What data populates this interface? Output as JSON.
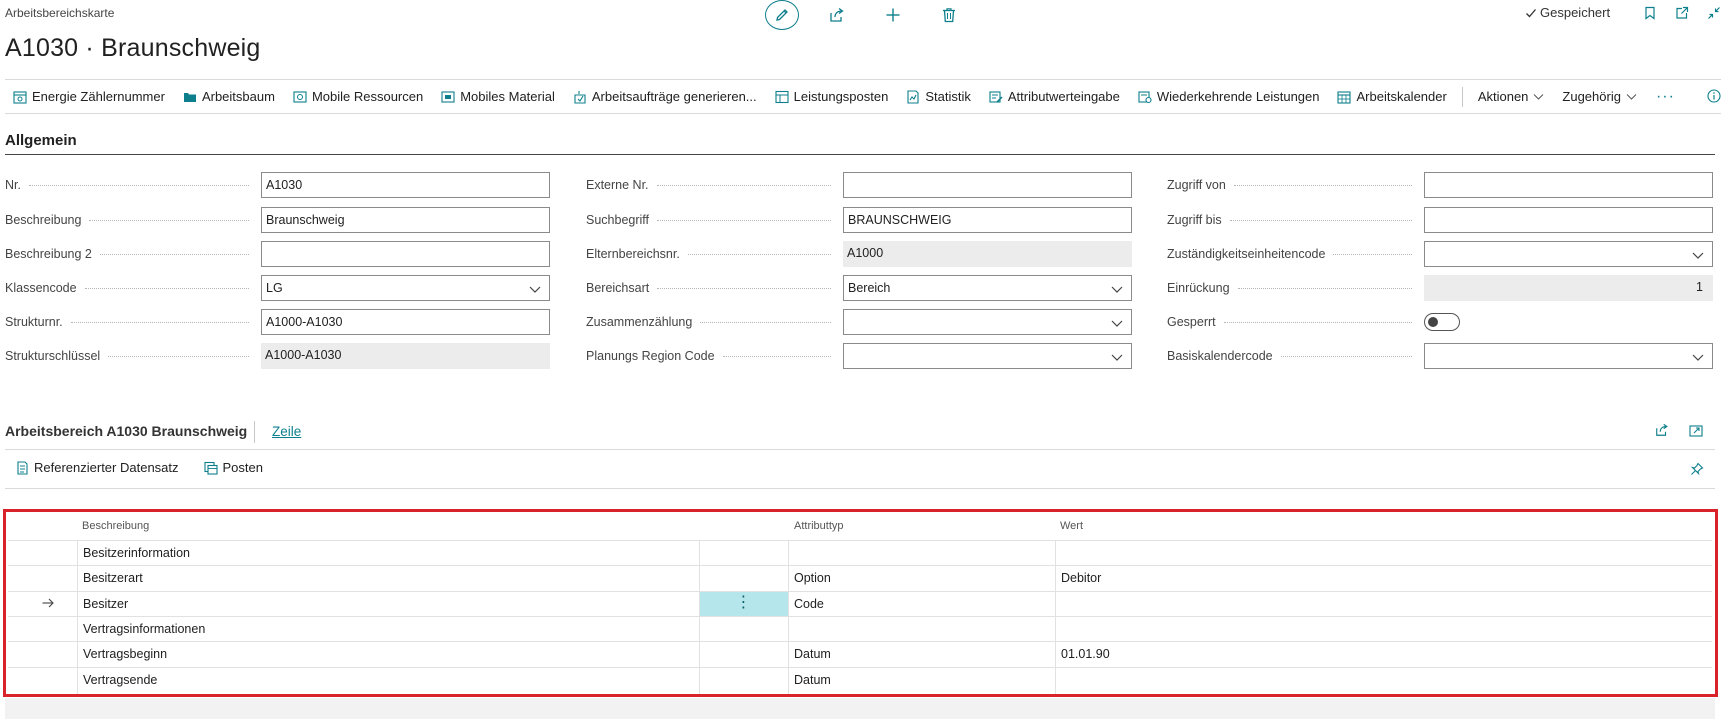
{
  "page": {
    "caption": "Arbeitsbereichskarte",
    "title": "A1030 · Braunschweig",
    "saved_label": "Gespeichert"
  },
  "top_icons": [
    "edit-icon",
    "share-icon",
    "add-icon",
    "delete-icon"
  ],
  "actions": [
    {
      "label": "Energie Zählernummer",
      "icon": "meter-icon"
    },
    {
      "label": "Arbeitsbaum",
      "icon": "folder-icon"
    },
    {
      "label": "Mobile Ressourcen",
      "icon": "resource-icon"
    },
    {
      "label": "Mobiles Material",
      "icon": "material-icon"
    },
    {
      "label": "Arbeitsaufträge generieren...",
      "icon": "generate-icon"
    },
    {
      "label": "Leistungsposten",
      "icon": "entries-icon"
    },
    {
      "label": "Statistik",
      "icon": "statistics-icon"
    },
    {
      "label": "Attributwerteingabe",
      "icon": "attribute-icon"
    },
    {
      "label": "Wiederkehrende Leistungen",
      "icon": "recurring-icon"
    },
    {
      "label": "Arbeitskalender",
      "icon": "calendar-icon"
    }
  ],
  "menus": {
    "actions": "Aktionen",
    "related": "Zugehörig",
    "more": "···"
  },
  "general": {
    "title": "Allgemein",
    "col1": [
      {
        "label": "Nr.",
        "value": "A1030",
        "kind": "text"
      },
      {
        "label": "Beschreibung",
        "value": "Braunschweig",
        "kind": "text"
      },
      {
        "label": "Beschreibung 2",
        "value": "",
        "kind": "text"
      },
      {
        "label": "Klassencode",
        "value": "LG",
        "kind": "select"
      },
      {
        "label": "Strukturnr.",
        "value": "A1000-A1030",
        "kind": "text"
      },
      {
        "label": "Strukturschlüssel",
        "value": "A1000-A1030",
        "kind": "readonly"
      }
    ],
    "col2": [
      {
        "label": "Externe Nr.",
        "value": "",
        "kind": "text"
      },
      {
        "label": "Suchbegriff",
        "value": "BRAUNSCHWEIG",
        "kind": "text"
      },
      {
        "label": "Elternbereichsnr.",
        "value": "A1000",
        "kind": "readonly"
      },
      {
        "label": "Bereichsart",
        "value": "Bereich",
        "kind": "select"
      },
      {
        "label": "Zusammenzählung",
        "value": "",
        "kind": "select"
      },
      {
        "label": "Planungs Region Code",
        "value": "",
        "kind": "select"
      }
    ],
    "col3": [
      {
        "label": "Zugriff von",
        "value": "",
        "kind": "text"
      },
      {
        "label": "Zugriff bis",
        "value": "",
        "kind": "text"
      },
      {
        "label": "Zuständigkeitseinheitencode",
        "value": "",
        "kind": "select"
      },
      {
        "label": "Einrückung",
        "value": "1",
        "kind": "readonly-num"
      },
      {
        "label": "Gesperrt",
        "value": false,
        "kind": "toggle"
      },
      {
        "label": "Basiskalendercode",
        "value": "",
        "kind": "select"
      }
    ]
  },
  "subpage": {
    "title": "Arbeitsbereich A1030 Braunschweig",
    "line_menu": "Zeile",
    "actions": [
      {
        "label": "Referenzierter Datensatz",
        "icon": "document-icon"
      },
      {
        "label": "Posten",
        "icon": "entries-icon"
      }
    ],
    "columns": [
      "Beschreibung",
      "Attributtyp",
      "Wert"
    ],
    "rows": [
      {
        "description": "Besitzerinformation",
        "type": "",
        "value": "",
        "current": false
      },
      {
        "description": "Besitzerart",
        "type": "Option",
        "value": "Debitor",
        "current": false
      },
      {
        "description": "Besitzer",
        "type": "Code",
        "value": "",
        "current": true
      },
      {
        "description": "Vertragsinformationen",
        "type": "",
        "value": "",
        "current": false
      },
      {
        "description": "Vertragsbeginn",
        "type": "Datum",
        "value": "01.01.90",
        "current": false
      },
      {
        "description": "Vertragsende",
        "type": "Datum",
        "value": "",
        "current": false
      }
    ],
    "row_menu_glyph": "⋮"
  },
  "colors": {
    "accent": "#0d7f8c",
    "highlight": "#d9232a",
    "selection": "#b4e6ec"
  }
}
